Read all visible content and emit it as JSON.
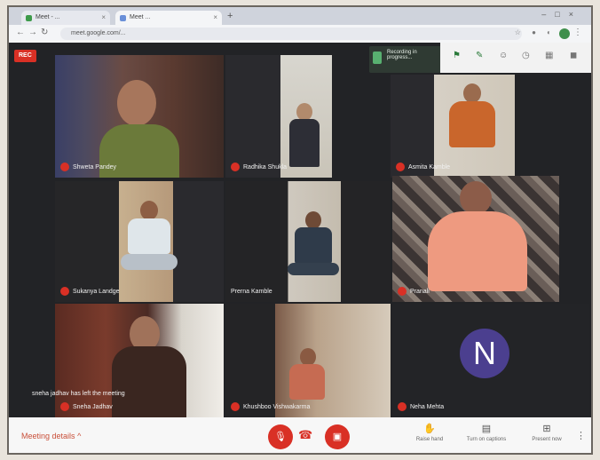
{
  "browser": {
    "tabs": [
      {
        "label": "Meet - ..."
      },
      {
        "label": "Meet ..."
      }
    ],
    "new_tab": "+",
    "url": "meet.google.com/..."
  },
  "meeting": {
    "rec_label": "REC",
    "toast": "Recording in progress...",
    "left_notice": "sneha jadhav has left the meeting",
    "participants": [
      {
        "name": "Shweta Pandey"
      },
      {
        "name": "Radhika Shukla"
      },
      {
        "name": "Asmita Kamble"
      },
      {
        "name": "Sukanya Landge"
      },
      {
        "name": "Prerna Kamble"
      },
      {
        "name": "Pranali"
      },
      {
        "name": "Sneha Jadhav"
      },
      {
        "name": "Khushboo Vishwakarma"
      },
      {
        "name": "Neha Mehta"
      }
    ],
    "avatar_letter": "N"
  },
  "bottom_bar": {
    "meeting_details": "Meeting details",
    "raise_hand": "Raise hand",
    "captions": "Turn on captions",
    "present": "Present now"
  },
  "colors": {
    "accent_red": "#d93025",
    "avatar_purple": "#4b3f8f",
    "meet_green": "#3f8f4c"
  }
}
